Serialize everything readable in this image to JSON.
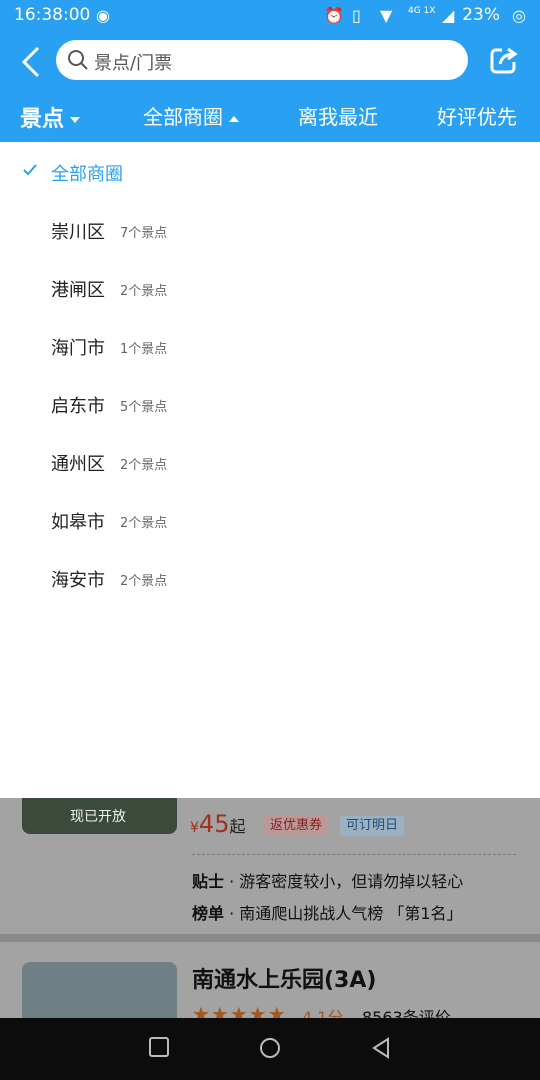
{
  "status_bar": {
    "time": "16:38:00",
    "network": "4G 1X",
    "battery_percent": "23%"
  },
  "header": {
    "search_placeholder": "景点/门票",
    "filters": [
      {
        "label": "景点"
      },
      {
        "label": "全部商圈"
      },
      {
        "label": "离我最近"
      },
      {
        "label": "好评优先"
      }
    ]
  },
  "dropdown": {
    "items": [
      {
        "name": "全部商圈",
        "count": "",
        "selected": true
      },
      {
        "name": "崇川区",
        "count": "7个景点"
      },
      {
        "name": "港闸区",
        "count": "2个景点"
      },
      {
        "name": "海门市",
        "count": "1个景点"
      },
      {
        "name": "启东市",
        "count": "5个景点"
      },
      {
        "name": "通州区",
        "count": "2个景点"
      },
      {
        "name": "如皋市",
        "count": "2个景点"
      },
      {
        "name": "海安市",
        "count": "2个景点"
      }
    ]
  },
  "cards": [
    {
      "open_status": "现已开放",
      "price_symbol": "¥",
      "price": "45",
      "price_suffix": "起",
      "tags": [
        "返优惠券",
        "可订明日"
      ],
      "tip_label": "贴士",
      "tip_text": "游客密度较小，但请勿掉以轻心",
      "rank_label": "榜单",
      "rank_text": "南通爬山挑战人气榜 「第1名」"
    },
    {
      "title": "南通水上乐园(3A)",
      "score": "4.1分",
      "reviews": "8563条评价"
    }
  ],
  "colors": {
    "primary": "#2aa0f3",
    "nav_bg": "#0c0c0c"
  }
}
